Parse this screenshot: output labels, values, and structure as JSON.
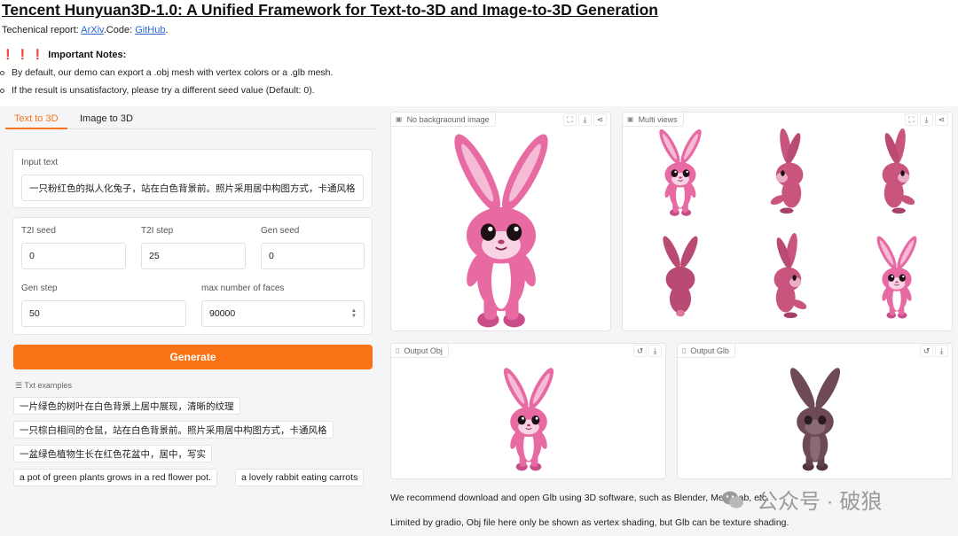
{
  "header": {
    "title": "Tencent Hunyuan3D-1.0: A Unified Framework for Text-to-3D and Image-to-3D Generation",
    "report_prefix": "Techenical report: ",
    "arxiv_link": "ArXiv",
    "code_prefix": ".Code: ",
    "github_link": "GitHub",
    "report_suffix": ".",
    "notes_bangs": "❗ ❗ ❗",
    "notes_title": "Important Notes:",
    "note_1": "By default, our demo can export a .obj mesh with vertex colors or a .glb mesh.",
    "note_2": "If the result is unsatisfactory, please try a different seed value (Default: 0)."
  },
  "tabs": {
    "text_to_3d": "Text to 3D",
    "image_to_3d": "Image to 3D"
  },
  "input_text": {
    "label": "Input text",
    "value": "一只粉红色的拟人化兔子，站在白色背景前。照片采用居中构图方式，卡通风格"
  },
  "params": {
    "t2i_seed_label": "T2I seed",
    "t2i_seed_value": "0",
    "t2i_step_label": "T2I step",
    "t2i_step_value": "25",
    "gen_seed_label": "Gen seed",
    "gen_seed_value": "0",
    "gen_step_label": "Gen step",
    "gen_step_value": "50",
    "max_faces_label": "max number of faces",
    "max_faces_value": "90000"
  },
  "generate_label": "Generate",
  "examples": {
    "title": "Txt examples",
    "items": [
      "一片绿色的树叶在白色背景上居中展现，清晰的纹理",
      "一只棕白相间的仓鼠，站在白色背景前。照片采用居中构图方式，卡通风格",
      "一盆绿色植物生长在红色花盆中，居中，写实",
      "a pot of green plants grows in a red flower pot.",
      "a lovely rabbit eating carrots"
    ]
  },
  "panels": {
    "no_bg": "No backgraound image",
    "multi_views": "Multi views",
    "output_obj": "Output Obj",
    "output_glb": "Output Glb"
  },
  "footer": {
    "recommend": "We recommend download and open Glb using 3D software, such as Blender, MeshLab, etc.",
    "limited": "Limited by gradio, Obj file here only be shown as vertex shading, but Glb can be texture shading."
  },
  "watermark": "公众号 · 破狼",
  "colors": {
    "accent": "#f97316",
    "link": "#2a64d6",
    "rabbit_pink": "#e76aa3",
    "glb_rabbit": "#6e4a55"
  },
  "icons": {
    "image": "image-icon",
    "fullscreen": "fullscreen-icon",
    "download": "download-icon",
    "share": "share-icon",
    "reset": "reset-icon",
    "file": "file-icon",
    "list": "list-icon"
  }
}
